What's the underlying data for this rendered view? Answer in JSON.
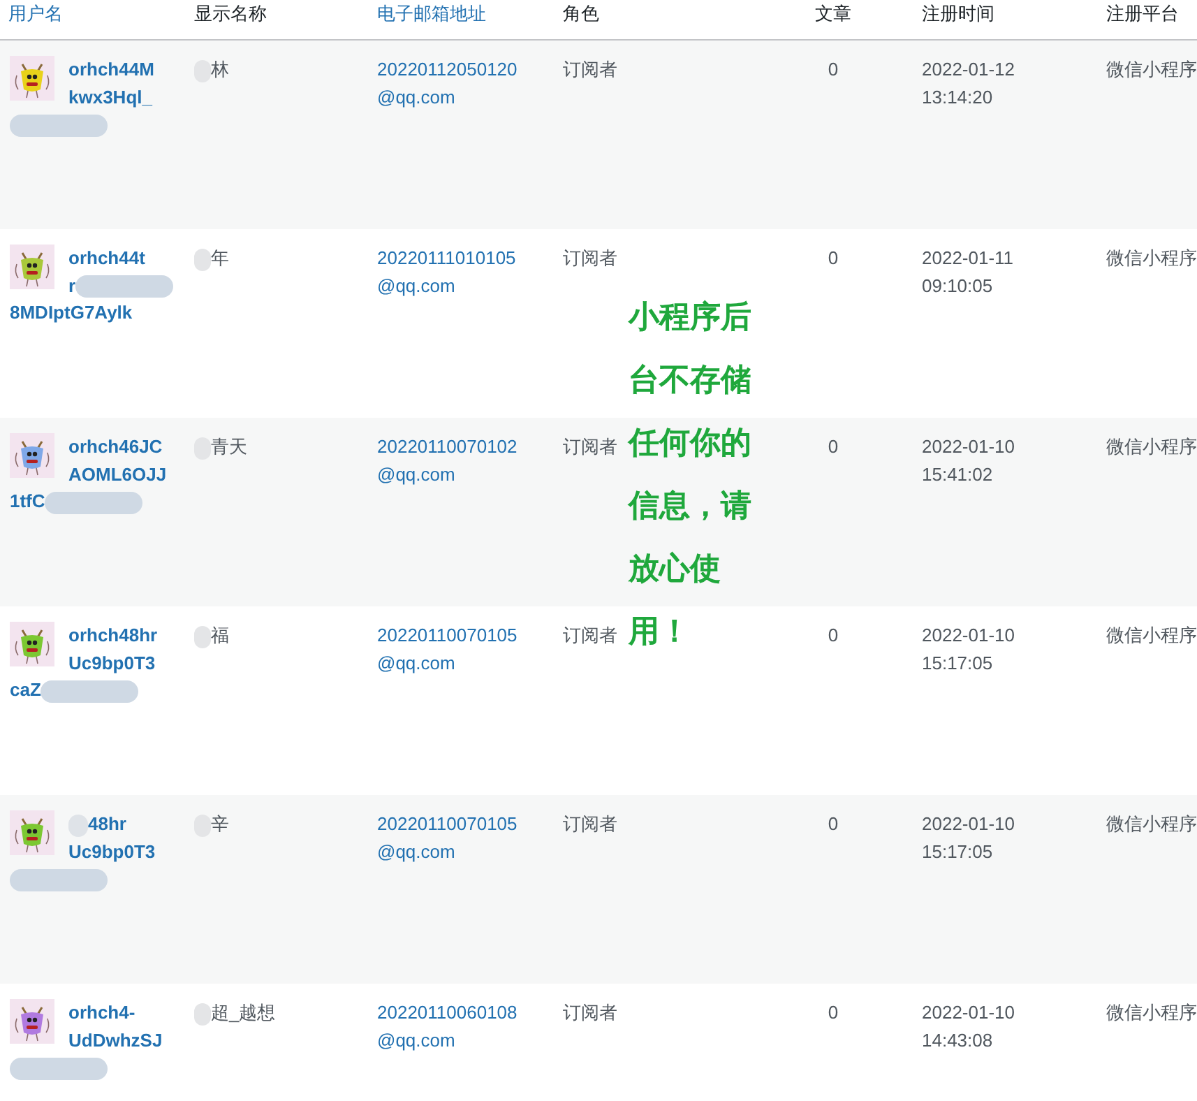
{
  "columns": [
    {
      "label": "用户名",
      "kind": "link"
    },
    {
      "label": "显示名称",
      "kind": "plain"
    },
    {
      "label": "电子邮箱地址",
      "kind": "link"
    },
    {
      "label": "角色",
      "kind": "plain"
    },
    {
      "label": "文章",
      "kind": "plain"
    },
    {
      "label": "注册时间",
      "kind": "plain"
    },
    {
      "label": "注册平台",
      "kind": "plain"
    }
  ],
  "rows": [
    {
      "color": "#e8d21a",
      "username_lines": [
        {
          "text": "orhch44M"
        },
        {
          "text": "kwx3Hql_"
        },
        {
          "blur": true
        }
      ],
      "display_name": "林",
      "email": "20220112050120@qq.com",
      "role": "订阅者",
      "posts": "0",
      "registered": "2022-01-12 13:14:20",
      "platform": "微信小程序"
    },
    {
      "color": "#a9c93a",
      "username_lines": [
        {
          "text": "orhch44t"
        },
        {
          "text": "r",
          "blur": true
        },
        {
          "text": "8MDIptG7Aylk"
        }
      ],
      "display_name": "年",
      "email": "20220111010105@qq.com",
      "role": "订阅者",
      "posts": "0",
      "registered": "2022-01-11 09:10:05",
      "platform": "微信小程序"
    },
    {
      "color": "#7fa8e8",
      "username_lines": [
        {
          "text": "orhch46JC"
        },
        {
          "text": "AOML6OJJ"
        },
        {
          "text": "1tfC",
          "blur": true
        }
      ],
      "display_name": "青天",
      "email": "20220110070102@qq.com",
      "role": "订阅者",
      "posts": "0",
      "registered": "2022-01-10 15:41:02",
      "platform": "微信小程序"
    },
    {
      "color": "#7cc832",
      "username_lines": [
        {
          "text": "orhch48hr"
        },
        {
          "text": "Uc9bp0T3"
        },
        {
          "text": "caZ",
          "blur": true
        }
      ],
      "display_name": "福",
      "email": "20220110070105@qq.com",
      "role": "订阅者",
      "posts": "0",
      "registered": "2022-01-10 15:17:05",
      "platform": "微信小程序"
    },
    {
      "color": "#7cc832",
      "username_lines": [
        {
          "text": "48hr",
          "blur": true
        },
        {
          "text": "Uc9bp0T3"
        },
        {
          "blur": true
        }
      ],
      "display_name": "辛",
      "email": "20220110070105@qq.com",
      "role": "订阅者",
      "posts": "0",
      "registered": "2022-01-10 15:17:05",
      "platform": "微信小程序"
    },
    {
      "color": "#b07ae0",
      "username_lines": [
        {
          "text": "orhch4-"
        },
        {
          "text": "UdDwhzSJ"
        },
        {
          "blur": true
        }
      ],
      "display_name": "超_越想",
      "email": "20220110060108@qq.com",
      "role": "订阅者",
      "posts": "0",
      "registered": "2022-01-10 14:43:08",
      "platform": "微信小程序"
    }
  ],
  "notice": "小程序后台不存储任何你的信息，请放心使用！"
}
